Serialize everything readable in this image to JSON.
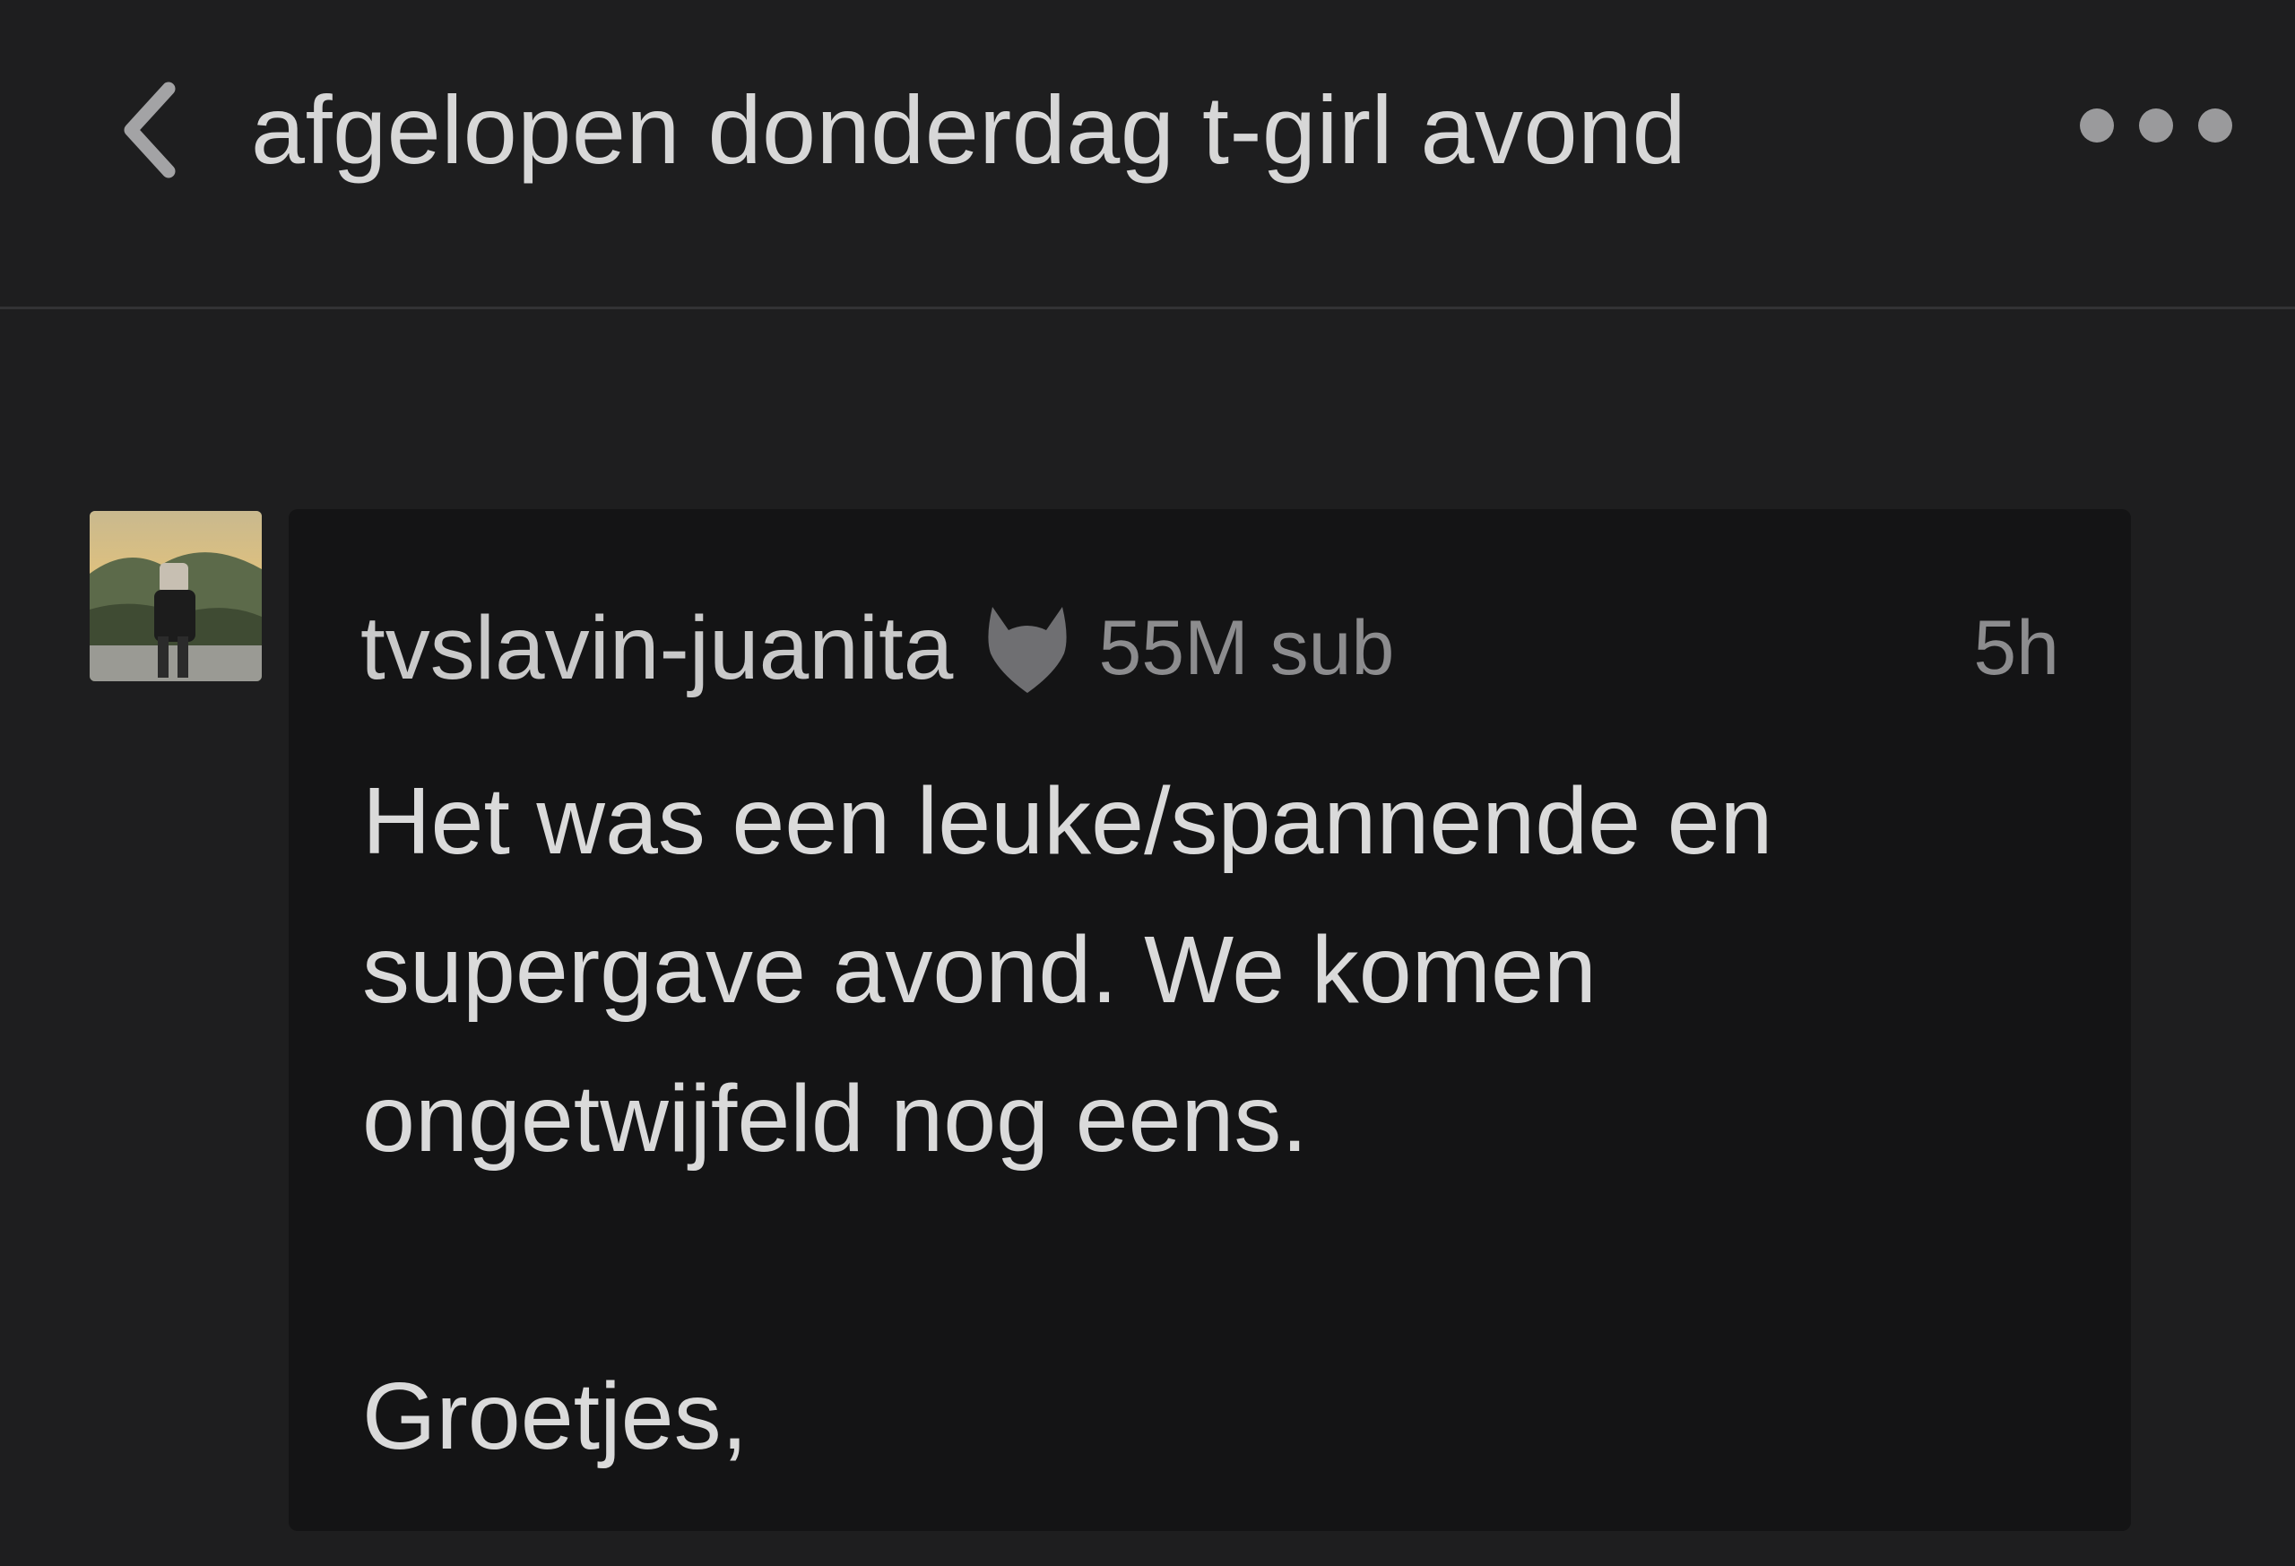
{
  "header": {
    "back_icon": "chevron-left-icon",
    "title": "afgelopen donderdag t-girl avond",
    "more_icon": "ellipsis-horizontal-icon"
  },
  "post": {
    "username": "tvslavin-juanita",
    "badge_icon": "devil-heart-icon",
    "sub_count": "55M sub",
    "time": "5h",
    "body_lines": [
      "Het was een leuke/spannende en",
      "supergave avond. We komen",
      "ongetwijfeld nog eens."
    ],
    "closing": "Groetjes,"
  },
  "colors": {
    "background": "#1e1e1f",
    "card": "#141415",
    "text": "#dadada",
    "muted": "#8c8c8e"
  }
}
